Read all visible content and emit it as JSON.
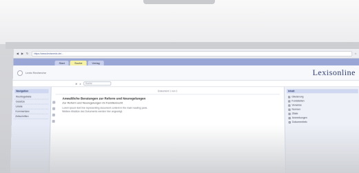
{
  "browser": {
    "url": "https://www.lexisnexis.de/...",
    "nav_icons": [
      "back-icon",
      "forward-icon",
      "reload-icon",
      "home-icon"
    ]
  },
  "tabs": [
    {
      "label": "Start",
      "active": false
    },
    {
      "label": "Suche",
      "active": true
    },
    {
      "label": "Verlag",
      "active": false
    }
  ],
  "header": {
    "brand": "Lexisonline",
    "left_text": "Lexis Recherche"
  },
  "search": {
    "placeholder": "Suche"
  },
  "leftnav": {
    "title": "Navigation",
    "items": [
      "Rechtsgebiete",
      "Gesetze",
      "Urteile",
      "Kommentare",
      "Zeitschriften"
    ]
  },
  "document": {
    "header": "Dokument 1 von 1",
    "title": "Anwaltliche Beratungen zur Reform und Neuregelungen",
    "subtitle": "Zur Reform und Neuregelungen im Familienrecht",
    "paragraphs": [
      "Lorem ipsum text line representing document content in the main reading pane.",
      "Weitere Absätze des Dokuments werden hier angezeigt."
    ]
  },
  "rightnav": {
    "title": "Inhalt",
    "items": [
      "Gliederung",
      "Fundstellen",
      "Verweise",
      "Normen",
      "Zitate",
      "Anmerkungen",
      "Dokumentinfo"
    ]
  },
  "colors": {
    "brand": "#2b3a6b",
    "tabbar": "#9aa7d6",
    "active_tab": "#f5f2a6"
  }
}
